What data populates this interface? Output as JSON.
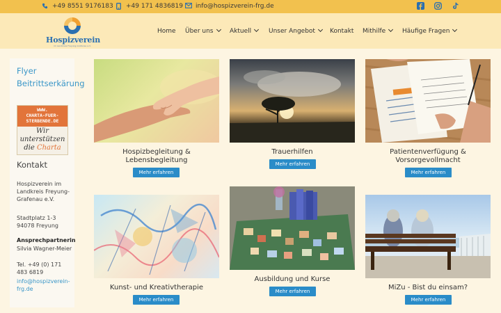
{
  "topbar": {
    "phone": "+49 8551 9176183",
    "mobile": "+49 171 4836819",
    "email": "info@hospizverein-frg.de",
    "social_icons": [
      "facebook-icon",
      "instagram-icon",
      "tiktok-icon"
    ]
  },
  "logo": {
    "name": "Hospizverein",
    "subtitle": "im Landkreis Freyung-Grafenau e.V."
  },
  "nav": {
    "items": [
      {
        "label": "Home"
      },
      {
        "label": "Über uns"
      },
      {
        "label": "Aktuell"
      },
      {
        "label": "Unser Angebot"
      },
      {
        "label": "Kontakt"
      },
      {
        "label": "Mithilfe"
      },
      {
        "label": "Häufige Fragen"
      }
    ]
  },
  "sidebar": {
    "flyer": "Flyer",
    "beitritt": "Beitrittserkärung",
    "charta_url_1": "WWW.",
    "charta_url_2": "CHARTA-FUER-",
    "charta_url_3": "STERBENDE.DE",
    "charta_text_1": "Wir",
    "charta_text_2": "unterstützen",
    "charta_text_3a": "die ",
    "charta_text_3b": "Charta",
    "kontakt_heading": "Kontakt",
    "org_name": "Hospizverein im Landkreis Freyung-Grafenau e.V.",
    "street": "Stadtplatz 1-3",
    "city": "94078 Freyung",
    "partner_label": "Ansprechpartnerin",
    "partner_name": "Silvia Wagner-Meier",
    "phone": "Tel. +49 (0) 171 483 6819",
    "email": "info@hospizverein-frg.de"
  },
  "cards": [
    {
      "title_1": "Hospizbegleitung &",
      "title_2": "Lebensbegleitung",
      "button": "Mehr erfahren"
    },
    {
      "title_1": "Trauerhilfen",
      "title_2": "",
      "button": "Mehr erfahren"
    },
    {
      "title_1": "Patientenverfügung &",
      "title_2": "Vorsorgevollmacht",
      "button": "Mehr erfahren"
    },
    {
      "title_1": "Kunst- und Kreativtherapie",
      "title_2": "",
      "button": "Mehr erfahren"
    },
    {
      "title_1": "Ausbildung und Kurse",
      "title_2": "",
      "button": "Mehr erfahren"
    },
    {
      "title_1": "MiZu - Bist du einsam?",
      "title_2": "",
      "button": "Mehr erfahren"
    }
  ],
  "colors": {
    "topbar": "#f2c14e",
    "header": "#fce9b8",
    "background": "#fdf5e2",
    "button": "#2a8cc8",
    "link": "#3a96c8"
  }
}
